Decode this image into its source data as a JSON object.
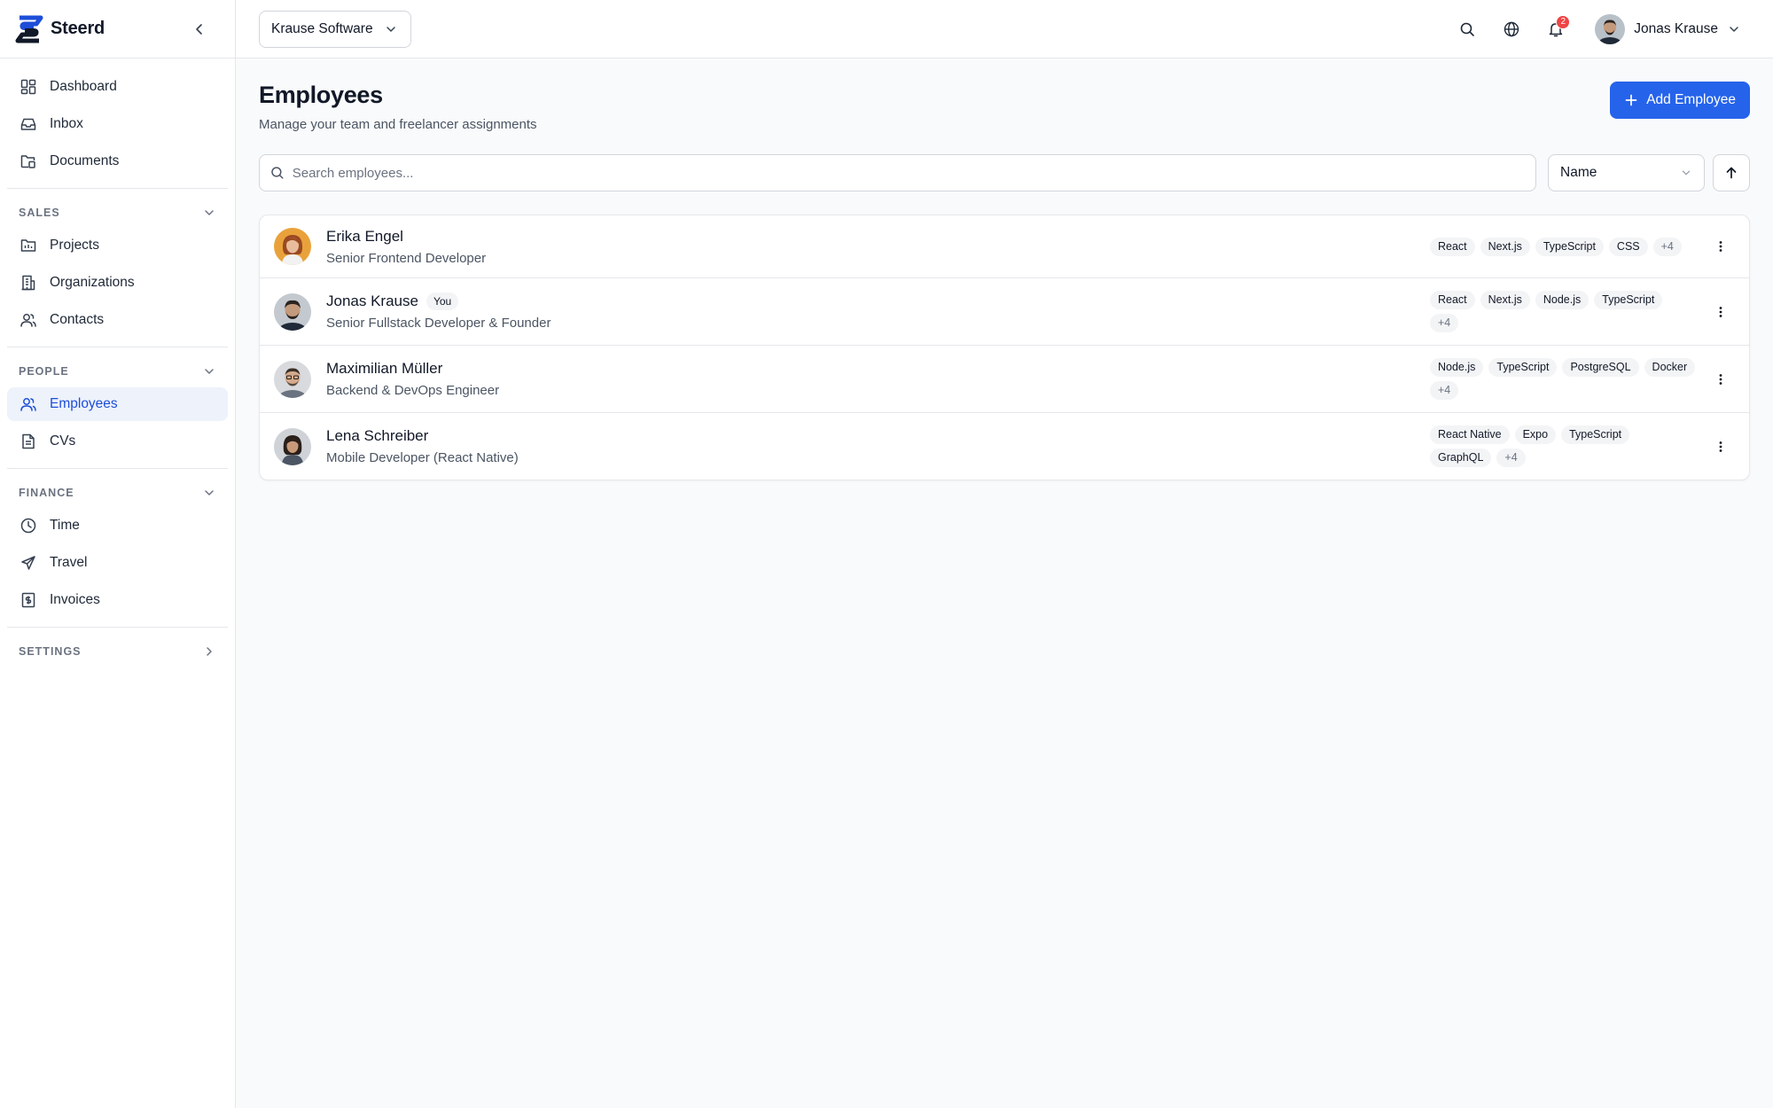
{
  "app": {
    "name": "Steerd"
  },
  "sidebar": {
    "main_items": [
      {
        "label": "Dashboard",
        "icon": "dashboard-icon"
      },
      {
        "label": "Inbox",
        "icon": "inbox-icon"
      },
      {
        "label": "Documents",
        "icon": "documents-icon"
      }
    ],
    "sections": [
      {
        "title": "SALES",
        "items": [
          {
            "label": "Projects",
            "icon": "folder-icon"
          },
          {
            "label": "Organizations",
            "icon": "building-icon"
          },
          {
            "label": "Contacts",
            "icon": "users-icon"
          }
        ]
      },
      {
        "title": "PEOPLE",
        "items": [
          {
            "label": "Employees",
            "icon": "user-icon",
            "active": true
          },
          {
            "label": "CVs",
            "icon": "file-text-icon"
          }
        ]
      },
      {
        "title": "FINANCE",
        "items": [
          {
            "label": "Time",
            "icon": "clock-icon"
          },
          {
            "label": "Travel",
            "icon": "plane-icon"
          },
          {
            "label": "Invoices",
            "icon": "receipt-icon"
          }
        ]
      }
    ],
    "settings_label": "SETTINGS"
  },
  "topbar": {
    "org": "Krause Software",
    "notifications_count": "2",
    "user_name": "Jonas Krause"
  },
  "page": {
    "title": "Employees",
    "subtitle": "Manage your team and freelancer assignments",
    "add_button": "Add Employee",
    "search_placeholder": "Search employees...",
    "sort_by": "Name"
  },
  "employees": [
    {
      "name": "Erika Engel",
      "role": "Senior Frontend Developer",
      "you": "",
      "tags": [
        "React",
        "Next.js",
        "TypeScript",
        "CSS"
      ],
      "more": "+4"
    },
    {
      "name": "Jonas Krause",
      "role": "Senior Fullstack Developer & Founder",
      "you": "You",
      "tags": [
        "React",
        "Next.js",
        "Node.js",
        "TypeScript"
      ],
      "more": "+4"
    },
    {
      "name": "Maximilian Müller",
      "role": "Backend & DevOps Engineer",
      "you": "",
      "tags": [
        "Node.js",
        "TypeScript",
        "PostgreSQL",
        "Docker"
      ],
      "more": "+4"
    },
    {
      "name": "Lena Schreiber",
      "role": "Mobile Developer (React Native)",
      "you": "",
      "tags": [
        "React Native",
        "Expo",
        "TypeScript",
        "GraphQL"
      ],
      "more": "+4"
    }
  ],
  "colors": {
    "accent": "#2563eb",
    "active_bg": "#edf2fb",
    "badge": "#ef4444"
  }
}
